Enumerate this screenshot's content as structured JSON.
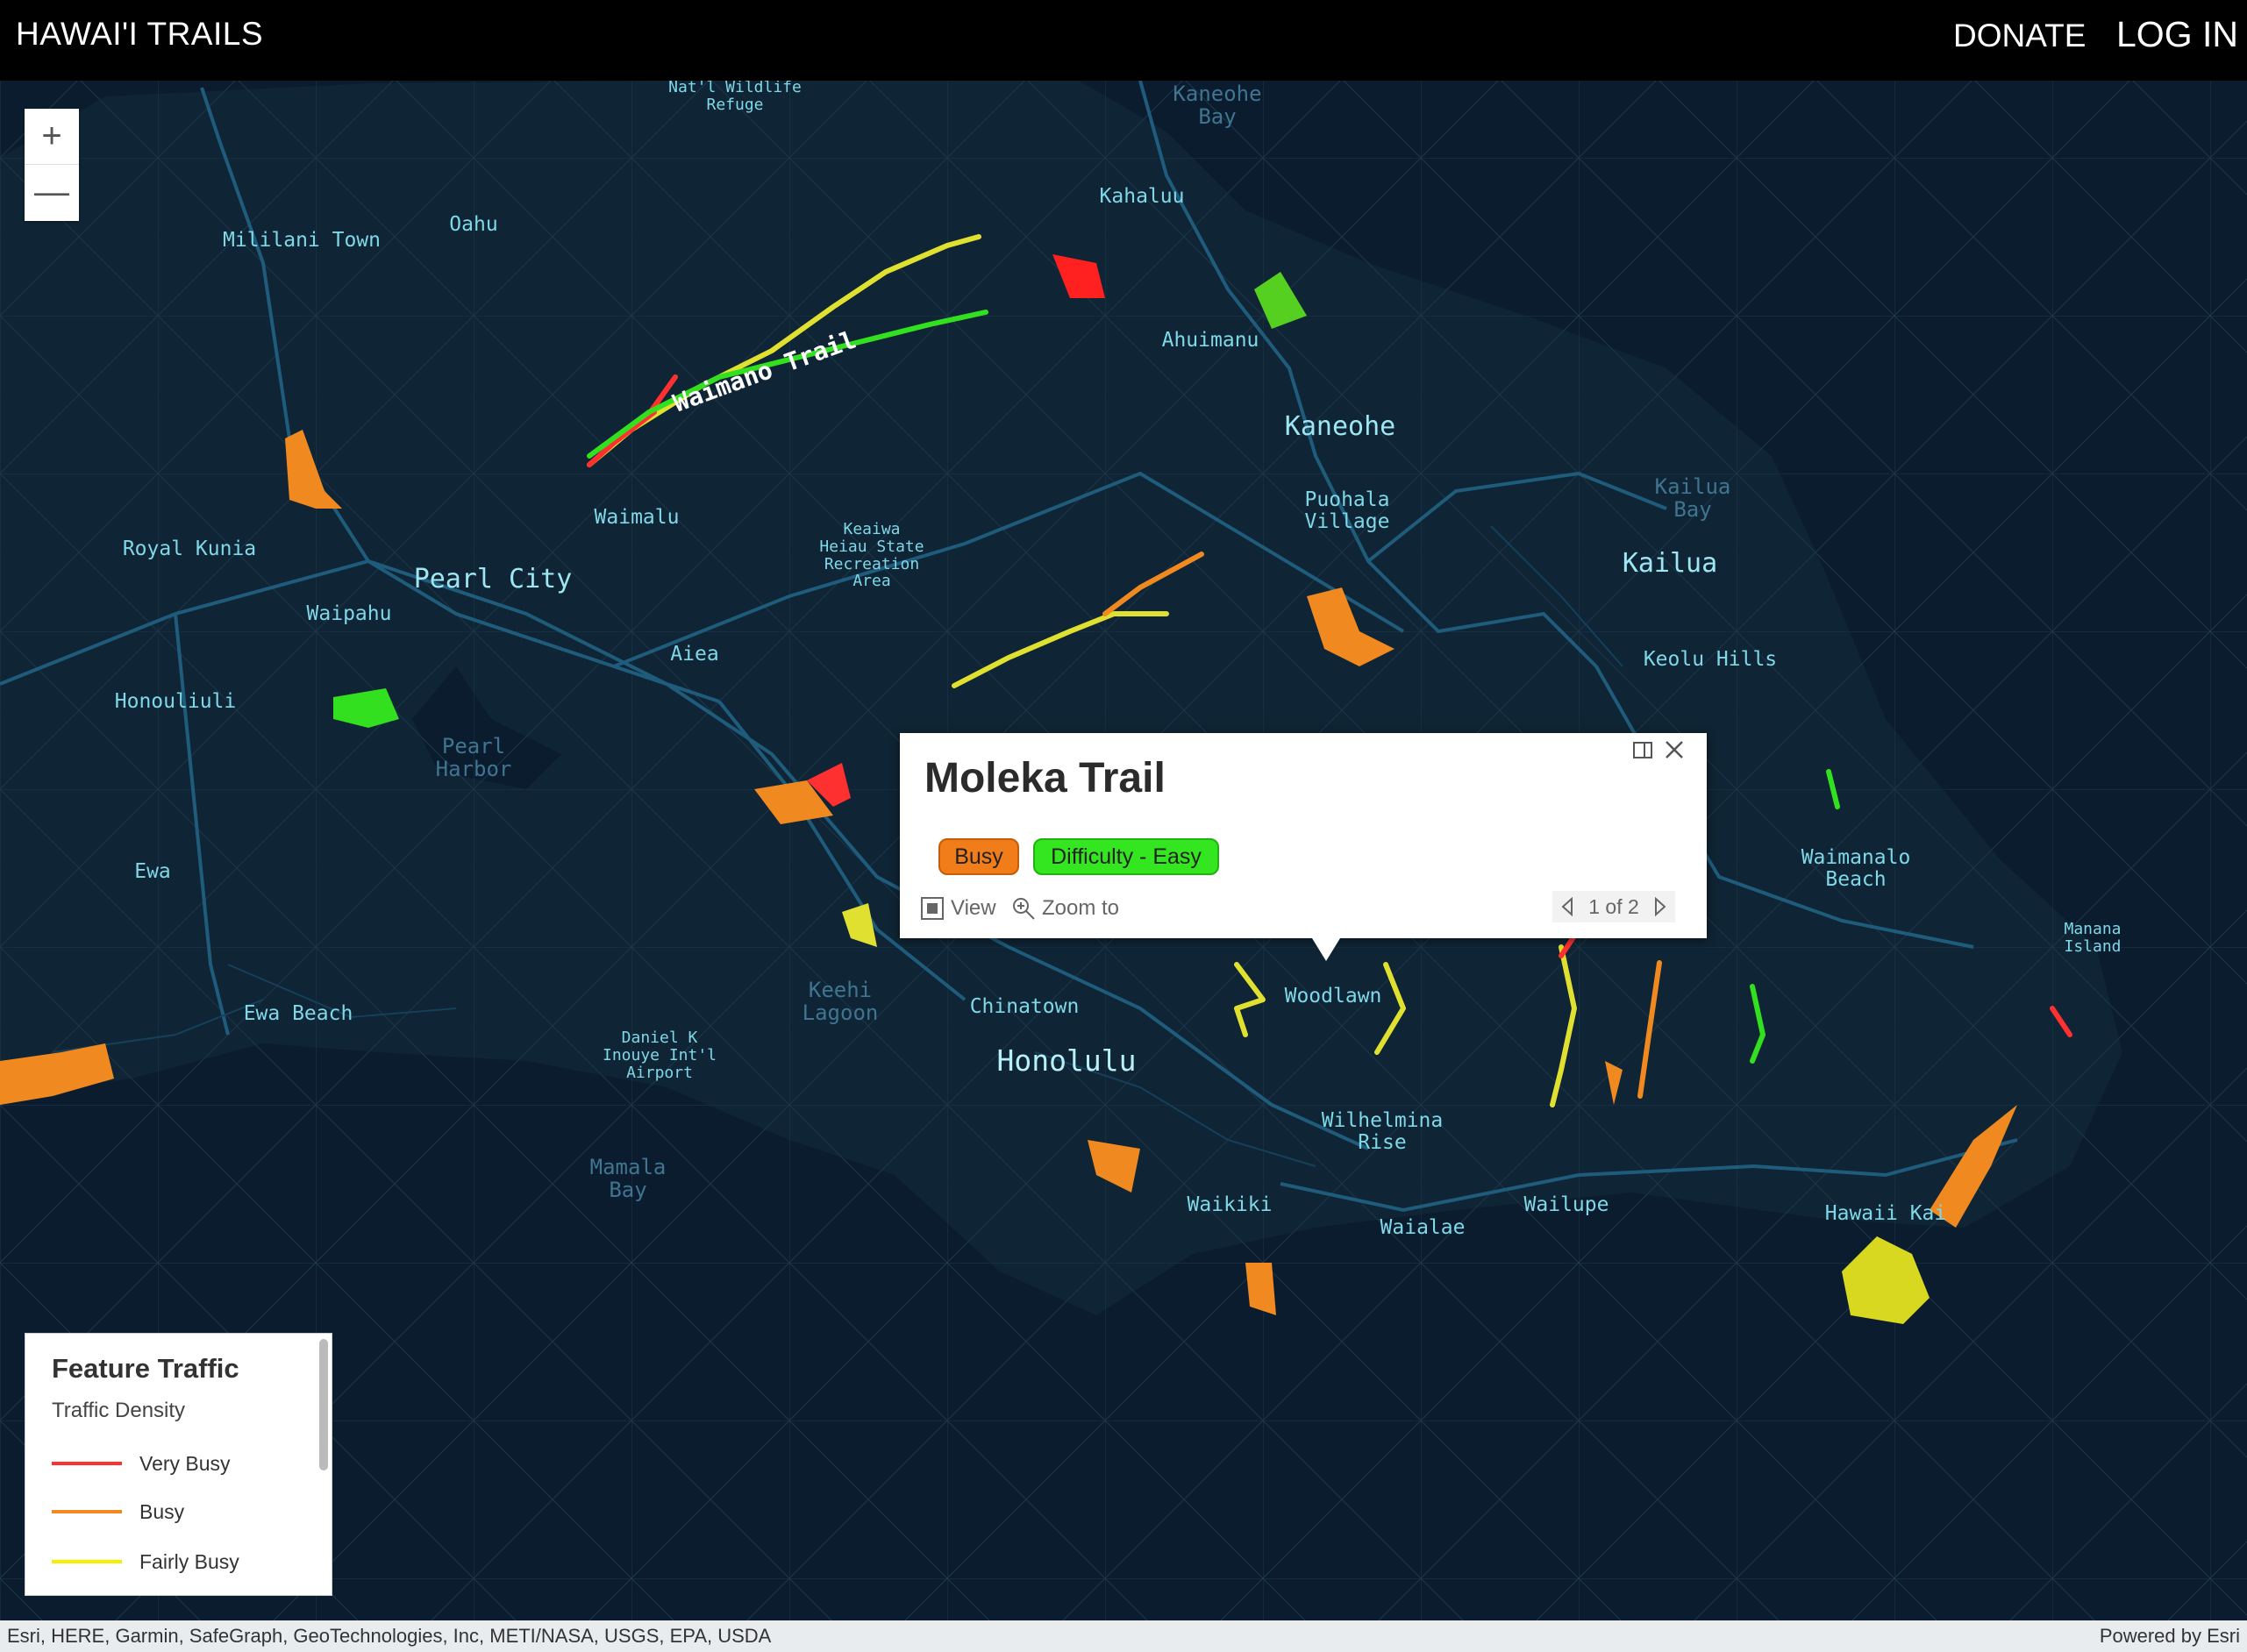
{
  "header": {
    "brand": "HAWAI'I TRAILS",
    "donate": "DONATE",
    "login": "LOG IN"
  },
  "zoom": {
    "in": "+",
    "out": "—"
  },
  "map_labels": [
    {
      "text": "Nat'l Wildlife\nRefuge",
      "cls": "small"
    },
    {
      "text": "Kaneohe\nBay",
      "cls": "water"
    },
    {
      "text": "Kahaluu",
      "cls": ""
    },
    {
      "text": "Mililani Town",
      "cls": ""
    },
    {
      "text": "Oahu",
      "cls": ""
    },
    {
      "text": "Ahuimanu",
      "cls": ""
    },
    {
      "text": "Kaneohe",
      "cls": "big"
    },
    {
      "text": "Kailua\nBay",
      "cls": "water"
    },
    {
      "text": "Waimalu",
      "cls": ""
    },
    {
      "text": "Keaiwa\nHeiau State\nRecreation\nArea",
      "cls": "small"
    },
    {
      "text": "Puohala\nVillage",
      "cls": ""
    },
    {
      "text": "Royal Kunia",
      "cls": ""
    },
    {
      "text": "Pearl City",
      "cls": "big"
    },
    {
      "text": "Kailua",
      "cls": "big"
    },
    {
      "text": "Waipahu",
      "cls": ""
    },
    {
      "text": "Aiea",
      "cls": ""
    },
    {
      "text": "Keolu Hills",
      "cls": ""
    },
    {
      "text": "Honouliuli",
      "cls": ""
    },
    {
      "text": "Pearl\nHarbor",
      "cls": "water"
    },
    {
      "text": "Waimanalo\nBeach",
      "cls": ""
    },
    {
      "text": "Ewa",
      "cls": ""
    },
    {
      "text": "Manana\nIsland",
      "cls": "small"
    },
    {
      "text": "Keehi\nLagoon",
      "cls": "water"
    },
    {
      "text": "Chinatown",
      "cls": ""
    },
    {
      "text": "Woodlawn",
      "cls": ""
    },
    {
      "text": "Ewa Beach",
      "cls": ""
    },
    {
      "text": "Daniel K\nInouye Int'l\nAirport",
      "cls": "small"
    },
    {
      "text": "Honolulu",
      "cls": "huge"
    },
    {
      "text": "Wilhelmina\nRise",
      "cls": ""
    },
    {
      "text": "Mamala\nBay",
      "cls": "water"
    },
    {
      "text": "Waikiki",
      "cls": ""
    },
    {
      "text": "Wailupe",
      "cls": ""
    },
    {
      "text": "Waialae",
      "cls": ""
    },
    {
      "text": "Hawaii Kai",
      "cls": ""
    }
  ],
  "trail_label": "Waimano Trail",
  "popup": {
    "title": "Moleka Trail",
    "chip_traffic": "Busy",
    "chip_difficulty": "Difficulty - Easy",
    "view_label": "View",
    "zoom_label": "Zoom to",
    "pager": "1 of 2"
  },
  "legend": {
    "title": "Feature Traffic",
    "subtitle": "Traffic Density",
    "items": [
      {
        "label": "Very Busy",
        "color": "#ff3030"
      },
      {
        "label": "Busy",
        "color": "#f08a20"
      },
      {
        "label": "Fairly Busy",
        "color": "#f4f000"
      }
    ]
  },
  "attribution": {
    "sources": "Esri, HERE, Garmin, SafeGraph, GeoTechnologies, Inc, METI/NASA, USGS, EPA, USDA",
    "powered": "Powered by Esri"
  },
  "colors": {
    "very_busy": "#ff3030",
    "busy": "#f08a20",
    "fairly_busy": "#e6e632",
    "not_busy": "#33e020",
    "water": "#0b1c2e",
    "land": "#0e2132",
    "road": "#1d5a7a"
  }
}
